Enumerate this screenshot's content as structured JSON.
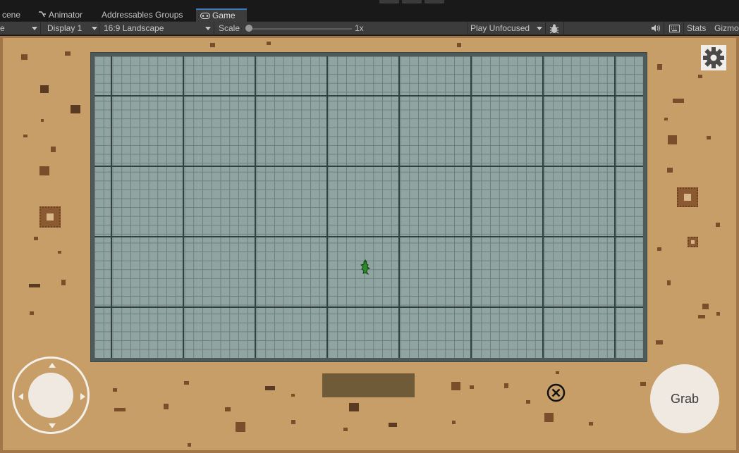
{
  "editor": {
    "tabs": [
      {
        "label": "cene",
        "icon": ""
      },
      {
        "label": "Animator",
        "icon": "animator-icon"
      },
      {
        "label": "Addressables Groups",
        "icon": ""
      },
      {
        "label": "Game",
        "icon": "gamepad-icon"
      }
    ],
    "active_tab": "Game",
    "toolbar": {
      "left_dropdown": "e",
      "display": "Display 1",
      "aspect": "16:9 Landscape",
      "scale_label": "Scale",
      "scale_value": "1x",
      "scale_level": 0.0,
      "play_mode": "Play Unfocused",
      "stats_label": "Stats",
      "gizmos_label": "Gizmo"
    }
  },
  "game": {
    "grab_label": "Grab",
    "icons": {
      "settings": "gear-icon",
      "cancel": "circle-x-icon",
      "player": "lizard-icon"
    },
    "colors": {
      "sand": "#c89e68",
      "floor": "#90a5a1",
      "player": "#2a8a2a",
      "ui_buttons": "#efe9e2"
    }
  }
}
